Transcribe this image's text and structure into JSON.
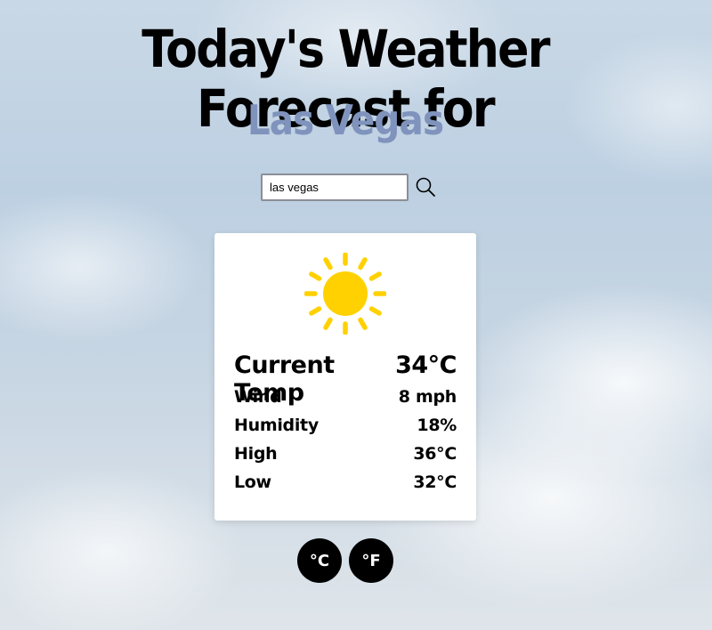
{
  "header": {
    "title": "Today's Weather Forecast for",
    "city": "Las Vegas"
  },
  "search": {
    "value": "las vegas",
    "icon": "search-icon"
  },
  "weather": {
    "icon": "sun-icon",
    "current_temp_label": "Current Temp",
    "current_temp_value": "34°C",
    "wind_label": "Wind",
    "wind_value": "8 mph",
    "humidity_label": "Humidity",
    "humidity_value": "18%",
    "high_label": "High",
    "high_value": "36°C",
    "low_label": "Low",
    "low_value": "32°C"
  },
  "units": {
    "celsius_label": "°C",
    "fahrenheit_label": "°F"
  },
  "colors": {
    "city": "#7f93bd",
    "sun": "#ffd100",
    "button_bg": "#000000"
  }
}
